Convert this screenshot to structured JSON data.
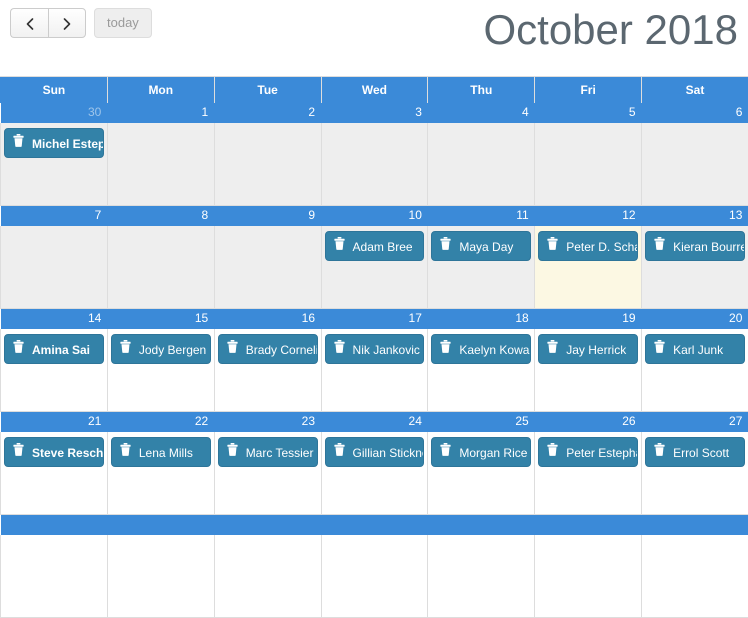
{
  "toolbar": {
    "prev_label": "‹",
    "next_label": "›",
    "today_label": "today",
    "prev_icon": "chevron-left-icon",
    "next_icon": "chevron-right-icon"
  },
  "header": {
    "title": "October 2018"
  },
  "colors": {
    "header_blue": "#3b8ad8",
    "event_teal": "#3382a8",
    "today_cream": "#fcf8e3",
    "past_grey": "#eeeeee",
    "border": "#dddddd",
    "title_text": "#5b6770",
    "other_month_text": "#9ec5ea"
  },
  "day_names": [
    "Sun",
    "Mon",
    "Tue",
    "Wed",
    "Thu",
    "Fri",
    "Sat"
  ],
  "weeks": [
    {
      "past": true,
      "days": [
        {
          "num": "30",
          "other_month": true,
          "today": false,
          "event": {
            "label": "Michel Esteph",
            "icon": "trash-icon",
            "bold": true
          }
        },
        {
          "num": "1",
          "other_month": false,
          "today": false,
          "event": null
        },
        {
          "num": "2",
          "other_month": false,
          "today": false,
          "event": null
        },
        {
          "num": "3",
          "other_month": false,
          "today": false,
          "event": null
        },
        {
          "num": "4",
          "other_month": false,
          "today": false,
          "event": null
        },
        {
          "num": "5",
          "other_month": false,
          "today": false,
          "event": null
        },
        {
          "num": "6",
          "other_month": false,
          "today": false,
          "event": null
        }
      ]
    },
    {
      "past": true,
      "days": [
        {
          "num": "7",
          "other_month": false,
          "today": false,
          "event": null
        },
        {
          "num": "8",
          "other_month": false,
          "today": false,
          "event": null
        },
        {
          "num": "9",
          "other_month": false,
          "today": false,
          "event": null
        },
        {
          "num": "10",
          "other_month": false,
          "today": false,
          "event": {
            "label": "Adam Bree",
            "icon": "trash-icon",
            "bold": false
          }
        },
        {
          "num": "11",
          "other_month": false,
          "today": false,
          "event": {
            "label": "Maya Day",
            "icon": "trash-icon",
            "bold": false
          }
        },
        {
          "num": "12",
          "other_month": false,
          "today": true,
          "event": {
            "label": "Peter D. Schali",
            "icon": "trash-icon",
            "bold": false
          }
        },
        {
          "num": "13",
          "other_month": false,
          "today": false,
          "event": {
            "label": "Kieran Bourre",
            "icon": "trash-icon",
            "bold": false
          }
        }
      ]
    },
    {
      "past": false,
      "days": [
        {
          "num": "14",
          "other_month": false,
          "today": false,
          "event": {
            "label": "Amina Sai",
            "icon": "trash-icon",
            "bold": true
          }
        },
        {
          "num": "15",
          "other_month": false,
          "today": false,
          "event": {
            "label": "Jody Bergen",
            "icon": "trash-icon",
            "bold": false
          }
        },
        {
          "num": "16",
          "other_month": false,
          "today": false,
          "event": {
            "label": "Brady Corneliu",
            "icon": "trash-icon",
            "bold": false
          }
        },
        {
          "num": "17",
          "other_month": false,
          "today": false,
          "event": {
            "label": "Nik Jankovic",
            "icon": "trash-icon",
            "bold": false
          }
        },
        {
          "num": "18",
          "other_month": false,
          "today": false,
          "event": {
            "label": "Kaelyn Kowalc",
            "icon": "trash-icon",
            "bold": false
          }
        },
        {
          "num": "19",
          "other_month": false,
          "today": false,
          "event": {
            "label": "Jay Herrick",
            "icon": "trash-icon",
            "bold": false
          }
        },
        {
          "num": "20",
          "other_month": false,
          "today": false,
          "event": {
            "label": "Karl Junk",
            "icon": "trash-icon",
            "bold": false
          }
        }
      ]
    },
    {
      "past": false,
      "days": [
        {
          "num": "21",
          "other_month": false,
          "today": false,
          "event": {
            "label": "Steve Reschko",
            "icon": "trash-icon",
            "bold": true
          }
        },
        {
          "num": "22",
          "other_month": false,
          "today": false,
          "event": {
            "label": "Lena Mills",
            "icon": "trash-icon",
            "bold": false
          }
        },
        {
          "num": "23",
          "other_month": false,
          "today": false,
          "event": {
            "label": "Marc Tessier",
            "icon": "trash-icon",
            "bold": false
          }
        },
        {
          "num": "24",
          "other_month": false,
          "today": false,
          "event": {
            "label": "Gillian Stickne",
            "icon": "trash-icon",
            "bold": false
          }
        },
        {
          "num": "25",
          "other_month": false,
          "today": false,
          "event": {
            "label": "Morgan Rice",
            "icon": "trash-icon",
            "bold": false
          }
        },
        {
          "num": "26",
          "other_month": false,
          "today": false,
          "event": {
            "label": "Peter Estephan",
            "icon": "trash-icon",
            "bold": false
          }
        },
        {
          "num": "27",
          "other_month": false,
          "today": false,
          "event": {
            "label": "Errol Scott",
            "icon": "trash-icon",
            "bold": false
          }
        }
      ]
    },
    {
      "past": false,
      "days": [
        {
          "num": "",
          "other_month": false,
          "today": false,
          "event": null
        },
        {
          "num": "",
          "other_month": false,
          "today": false,
          "event": null
        },
        {
          "num": "",
          "other_month": false,
          "today": false,
          "event": null
        },
        {
          "num": "",
          "other_month": false,
          "today": false,
          "event": null
        },
        {
          "num": "",
          "other_month": false,
          "today": false,
          "event": null
        },
        {
          "num": "",
          "other_month": false,
          "today": false,
          "event": null
        },
        {
          "num": "",
          "other_month": false,
          "today": false,
          "event": null
        }
      ]
    }
  ]
}
